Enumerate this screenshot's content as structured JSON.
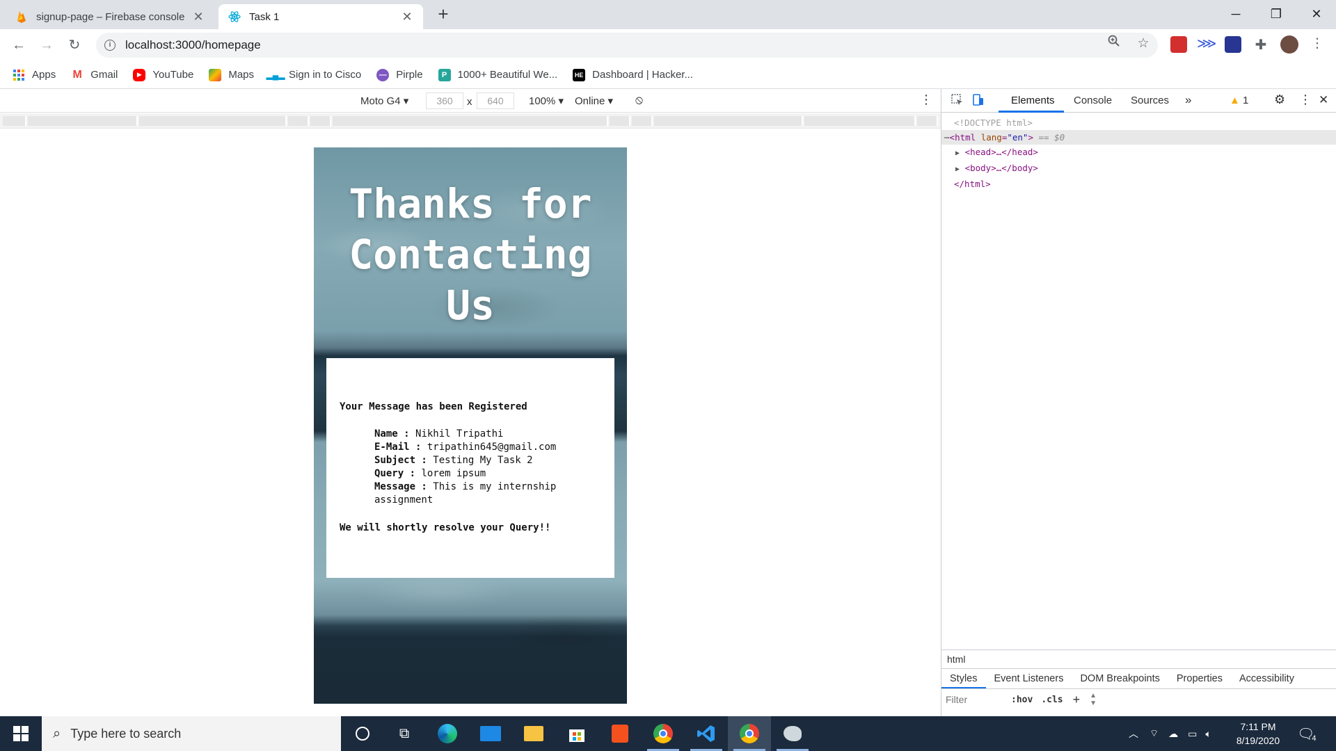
{
  "browser": {
    "tabs": [
      {
        "title": "signup-page – Firebase console",
        "active": false
      },
      {
        "title": "Task 1",
        "active": true
      }
    ],
    "url": "localhost:3000/homepage",
    "bookmarks": [
      "Apps",
      "Gmail",
      "YouTube",
      "Maps",
      "Sign in to Cisco",
      "Pirple",
      "1000+ Beautiful We...",
      "Dashboard | Hacker..."
    ]
  },
  "device_toolbar": {
    "device": "Moto G4",
    "width": "360",
    "height": "640",
    "times": "x",
    "zoom": "100%",
    "network": "Online"
  },
  "page": {
    "title": "Thanks for Contacting Us",
    "heading": "Your Message has been Registered",
    "fields": [
      {
        "label": "Name :",
        "value": "Nikhil Tripathi"
      },
      {
        "label": "E-Mail :",
        "value": "tripathin645@gmail.com"
      },
      {
        "label": "Subject :",
        "value": "Testing My Task 2"
      },
      {
        "label": "Query :",
        "value": "lorem ipsum"
      },
      {
        "label": "Message :",
        "value": "This is my internship assignment"
      }
    ],
    "footer": "We will shortly resolve your Query!!"
  },
  "devtools": {
    "tabs": [
      "Elements",
      "Console",
      "Sources",
      "»"
    ],
    "warnings": "1",
    "dom": {
      "doctype": "<!DOCTYPE html>",
      "html_open": "html",
      "lang_attr": "lang",
      "lang_value": "\"en\"",
      "selected_marker": "== $0",
      "head": "<head>…</head>",
      "body": "<body>…</body>",
      "html_close": "</html>"
    },
    "breadcrumb": "html",
    "styles_tabs": [
      "Styles",
      "Event Listeners",
      "DOM Breakpoints",
      "Properties",
      "Accessibility"
    ],
    "filter_placeholder": "Filter",
    "hov": ":hov",
    "cls": ".cls",
    "plus": "+"
  },
  "taskbar": {
    "search_placeholder": "Type here to search",
    "time": "7:11 PM",
    "date": "8/19/2020",
    "notifications": "4"
  },
  "colors": {
    "accent": "#1a73e8",
    "taskbar": "#1b2a3d",
    "tab_strip": "#dee1e6"
  }
}
